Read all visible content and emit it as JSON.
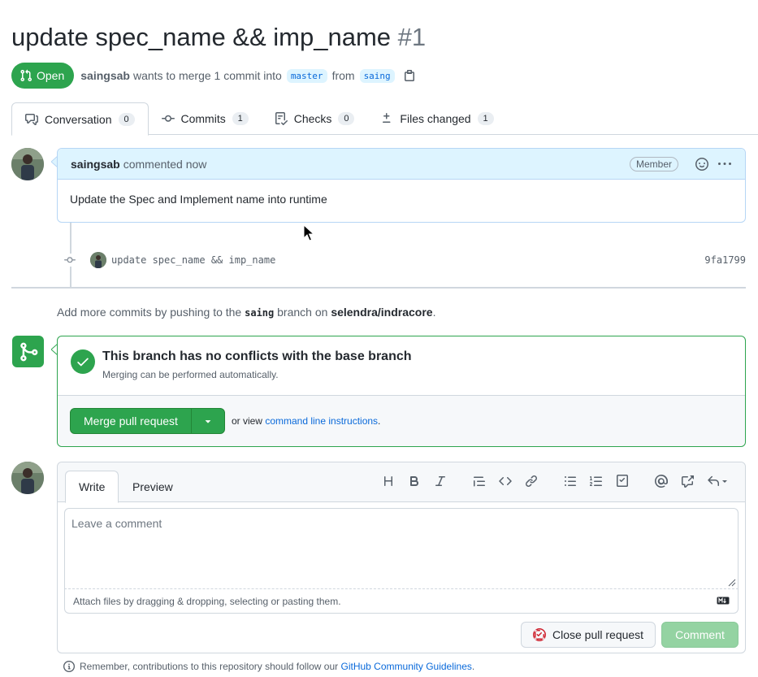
{
  "pr": {
    "title": "update spec_name && imp_name",
    "number": "#1",
    "state": "Open",
    "author": "saingsab",
    "merge_text": "wants to merge 1 commit into",
    "base_branch": "master",
    "from_text": "from",
    "head_branch": "saing"
  },
  "tabs": [
    {
      "label": "Conversation",
      "count": "0",
      "icon": "comment-discussion-icon"
    },
    {
      "label": "Commits",
      "count": "1",
      "icon": "git-commit-icon"
    },
    {
      "label": "Checks",
      "count": "0",
      "icon": "checklist-icon"
    },
    {
      "label": "Files changed",
      "count": "1",
      "icon": "file-diff-icon"
    }
  ],
  "comment": {
    "author": "saingsab",
    "time": "commented now",
    "role": "Member",
    "body": "Update the Spec and Implement name into runtime"
  },
  "commit": {
    "message": "update spec_name && imp_name",
    "sha": "9fa1799"
  },
  "push_hint": {
    "prefix": "Add more commits by pushing to the",
    "branch": "saing",
    "middle": "branch on",
    "repo": "selendra/indracore",
    "suffix": "."
  },
  "merge": {
    "title": "This branch has no conflicts with the base branch",
    "subtitle": "Merging can be performed automatically.",
    "button": "Merge pull request",
    "or_view": "or view",
    "cli_link": "command line instructions",
    "period": "."
  },
  "form": {
    "tab_write": "Write",
    "tab_preview": "Preview",
    "placeholder": "Leave a comment",
    "attach_text": "Attach files by dragging & dropping, selecting or pasting them.",
    "close_button": "Close pull request",
    "comment_button": "Comment",
    "toolbar": [
      "heading-icon",
      "bold-icon",
      "italic-icon",
      "quote-icon",
      "code-icon",
      "link-icon",
      "unordered-list-icon",
      "ordered-list-icon",
      "tasklist-icon",
      "mention-icon",
      "cross-reference-icon",
      "reply-icon"
    ]
  },
  "guidelines": {
    "prefix": "Remember, contributions to this repository should follow our",
    "link": "GitHub Community Guidelines",
    "suffix": "."
  },
  "colors": {
    "accent": "#0969da",
    "success": "#2da44e",
    "muted": "#57606a"
  }
}
